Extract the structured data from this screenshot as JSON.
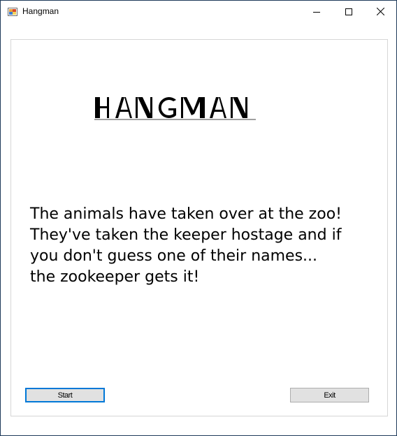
{
  "window": {
    "title": "Hangman"
  },
  "logo": {
    "text": "HANGMAN"
  },
  "story": {
    "lines": [
      "The animals have taken over at the zoo!",
      "They've taken the keeper hostage and if",
      "you don't guess one of their names...",
      "the zookeeper gets it!"
    ]
  },
  "buttons": {
    "start_label": "Start",
    "exit_label": "Exit"
  },
  "icons": {
    "app": "app-window-icon",
    "minimize": "minimize-icon",
    "maximize": "maximize-icon",
    "close": "close-icon"
  },
  "colors": {
    "focus_border": "#0078d7",
    "button_face": "#e1e1e1"
  }
}
